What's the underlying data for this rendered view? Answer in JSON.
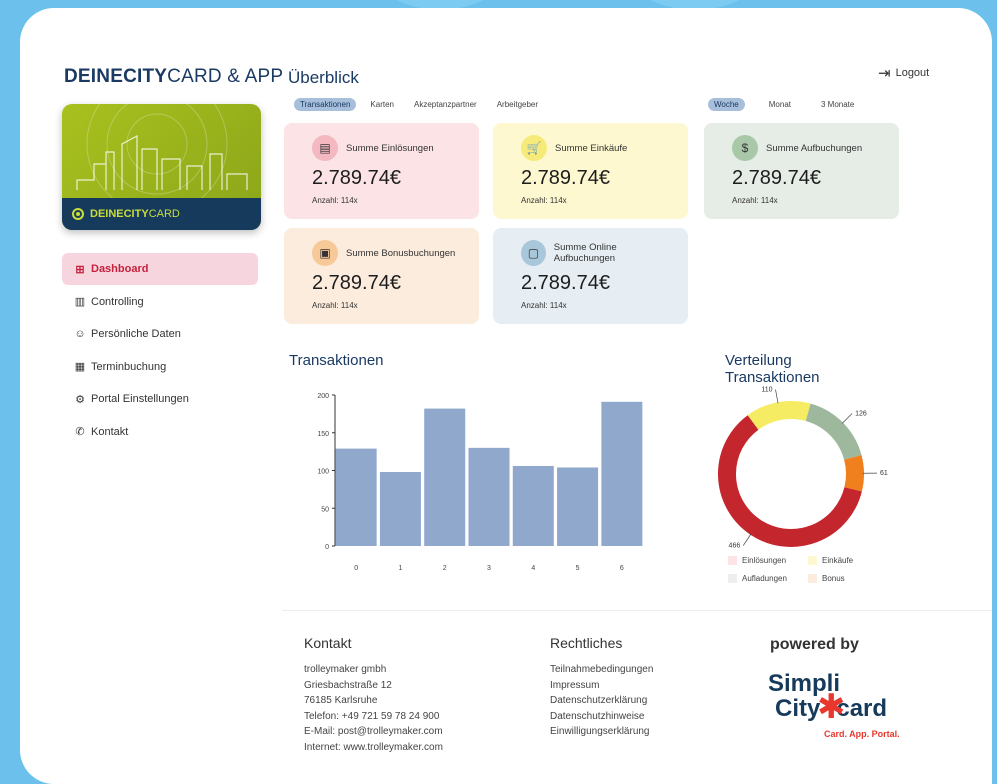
{
  "brand": {
    "bold": "DEINECITY",
    "rest": "CARD & APP"
  },
  "card": {
    "bold": "DEINECITY",
    "light": "CARD"
  },
  "sidebar": {
    "items": [
      {
        "label": "Dashboard",
        "icon": "grid-icon",
        "active": true
      },
      {
        "label": "Controlling",
        "icon": "bar-chart-icon"
      },
      {
        "label": "Persönliche Daten",
        "icon": "user-icon"
      },
      {
        "label": "Terminbuchung",
        "icon": "calendar-icon"
      },
      {
        "label": "Portal Einstellungen",
        "icon": "user-settings-icon"
      },
      {
        "label": "Kontakt",
        "icon": "phone-icon"
      }
    ]
  },
  "header": {
    "title": "Überblick",
    "logout": "Logout"
  },
  "tabs_left": [
    "Transaktionen",
    "Karten",
    "Akzeptanzpartner",
    "Arbeitgeber"
  ],
  "tabs_right": [
    "Woche",
    "Monat",
    "3 Monate"
  ],
  "kpis": [
    {
      "label": "Summe Einlösungen",
      "value": "2.789.74€",
      "count": "Anzahl: 114x",
      "icon": "cash-register-icon",
      "bg": "#fbe3e6",
      "badge": "#f3b8c0"
    },
    {
      "label": "Summe Einkäufe",
      "value": "2.789.74€",
      "count": "Anzahl: 114x",
      "icon": "cart-icon",
      "bg": "#fdf8cf",
      "badge": "#f6ea7a"
    },
    {
      "label": "Summe Aufbuchungen",
      "value": "2.789.74€",
      "count": "Anzahl: 114x",
      "icon": "money-add-icon",
      "bg": "#e6ece6",
      "badge": "#a8c8a8"
    },
    {
      "label": "Summe Bonusbuchungen",
      "value": "2.789.74€",
      "count": "Anzahl: 114x",
      "icon": "gift-icon",
      "bg": "#fcecdd",
      "badge": "#f8c998"
    },
    {
      "label": "Summe Online Aufbuchungen",
      "value": "2.789.74€",
      "count": "Anzahl: 114x",
      "icon": "online-icon",
      "bg": "#e6eef3",
      "badge": "#a9c7db"
    }
  ],
  "chart_titles": {
    "bar": "Transaktionen",
    "donut_1": "Verteilung",
    "donut_2": "Transaktionen"
  },
  "chart_data": [
    {
      "type": "bar",
      "categories": [
        "0",
        "1",
        "2",
        "3",
        "4",
        "5",
        "6"
      ],
      "values": [
        129,
        98,
        182,
        130,
        106,
        104,
        191
      ],
      "ylim": [
        0,
        200
      ],
      "yticks": [
        0,
        50,
        100,
        150,
        200
      ],
      "color": "#8fa8cc"
    },
    {
      "type": "pie",
      "labels": [
        "Einlösungen",
        "Einkäufe",
        "Aufladungen",
        "Bonus"
      ],
      "values": [
        466,
        110,
        126,
        61
      ],
      "colors": [
        "#c4262e",
        "#f5ec63",
        "#9db89c",
        "#f07f1d"
      ],
      "legend_colors": [
        "#fbe3e6",
        "#fdf8cf",
        "#eeeeee",
        "#fcecdd"
      ]
    }
  ],
  "footer": {
    "kontakt": {
      "title": "Kontakt",
      "lines": [
        "trolleymaker gmbh",
        "Griesbachstraße 12",
        "76185 Karlsruhe",
        "Telefon: +49 721 59 78 24 900",
        "E-Mail: post@trolleymaker.com",
        "Internet: www.trolleymaker.com"
      ]
    },
    "rechtliches": {
      "title": "Rechtliches",
      "lines": [
        "Teilnahmebedingungen",
        "Impressum",
        "Datenschutzerklärung",
        "Datenschutzhinweise",
        "Einwilligungserklärung"
      ]
    },
    "powered": "powered by",
    "logo": {
      "line1": "Simpli",
      "line2": "City",
      "line3": "card",
      "tagline": "Card. App. Portal."
    }
  }
}
